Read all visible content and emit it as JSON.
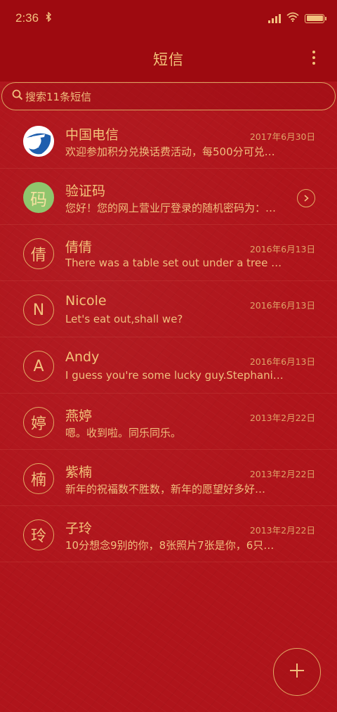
{
  "status_bar": {
    "time": "2:36"
  },
  "app_bar": {
    "title": "短信"
  },
  "search": {
    "placeholder": "搜索11条短信"
  },
  "conversations": [
    {
      "name": "中国电信",
      "date": "2017年6月30日",
      "preview": "欢迎参加积分兑换话费活动，每500分可兑…",
      "avatar": "telecom-logo"
    },
    {
      "name": "验证码",
      "date": "",
      "preview": "您好！您的网上营业厅登录的随机密码为：…",
      "avatar_text": "码",
      "avatar_color": "#8fc56d"
    },
    {
      "name": "倩倩",
      "date": "2016年6月13日",
      "preview": "There was a table set out under a tree in…",
      "avatar_text": "倩"
    },
    {
      "name": "Nicole",
      "date": "2016年6月13日",
      "preview": "Let's eat out,shall we?",
      "avatar_text": "N"
    },
    {
      "name": "Andy",
      "date": "2016年6月13日",
      "preview": "I guess you're some lucky guy.Stephani…",
      "avatar_text": "A"
    },
    {
      "name": "燕婷",
      "date": "2013年2月22日",
      "preview": "嗯。收到啦。同乐同乐。",
      "avatar_text": "婷"
    },
    {
      "name": "紫楠",
      "date": "2013年2月22日",
      "preview": "新年的祝福数不胜数，新年的愿望好多好…",
      "avatar_text": "楠"
    },
    {
      "name": "子玲",
      "date": "2013年2月22日",
      "preview": "10分想念9别的你，8张照片7张是你，6只…",
      "avatar_text": "玲"
    }
  ],
  "colors": {
    "background": "#b0141b",
    "bar": "#9e0a10",
    "accent": "#f3c37a"
  },
  "icons": [
    "bluetooth-icon",
    "signal-icon",
    "wifi-icon",
    "battery-icon",
    "more-vert-icon",
    "search-icon",
    "chevron-right-icon",
    "plus-icon"
  ]
}
